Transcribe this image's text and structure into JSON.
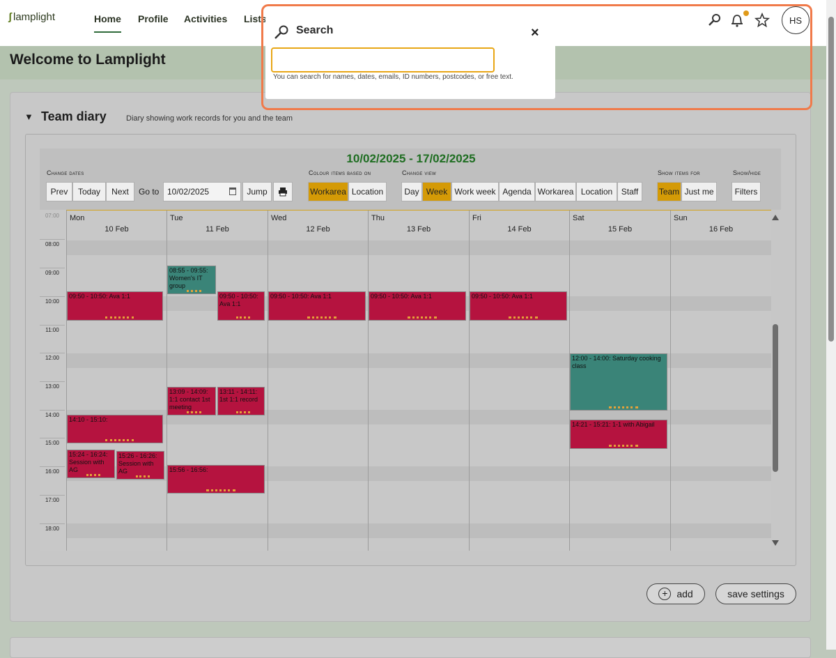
{
  "app": {
    "logo_text": "lamplight"
  },
  "nav": {
    "items": [
      {
        "label": "Home"
      },
      {
        "label": "Profile"
      },
      {
        "label": "Activities"
      },
      {
        "label": "Lists"
      }
    ],
    "user_initials": "HS"
  },
  "page": {
    "title": "Welcome to Lamplight"
  },
  "diary": {
    "title": "Team diary",
    "description": "Diary showing work records for you and the team",
    "range_title": "10/02/2025 - 17/02/2025",
    "labels": {
      "change_dates": "Change dates",
      "colour_items": "Colour items based on",
      "change_view": "Change view",
      "show_items_for": "Show items for",
      "show_hide": "Show/hide"
    },
    "buttons": {
      "prev": "Prev",
      "today": "Today",
      "next": "Next",
      "go_to": "Go to",
      "jump": "Jump",
      "workarea": "Workarea",
      "location": "Location",
      "day": "Day",
      "week": "Week",
      "work_week": "Work week",
      "agenda": "Agenda",
      "view_workarea": "Workarea",
      "view_location": "Location",
      "staff": "Staff",
      "team": "Team",
      "just_me": "Just me",
      "filters": "Filters"
    },
    "date_value": "10/02/2025",
    "days": [
      {
        "name": "Mon",
        "date": "10 Feb"
      },
      {
        "name": "Tue",
        "date": "11 Feb"
      },
      {
        "name": "Wed",
        "date": "12 Feb"
      },
      {
        "name": "Thu",
        "date": "13 Feb"
      },
      {
        "name": "Fri",
        "date": "14 Feb"
      },
      {
        "name": "Sat",
        "date": "15 Feb"
      },
      {
        "name": "Sun",
        "date": "16 Feb"
      }
    ],
    "hours": [
      "07:00",
      "08:00",
      "09:00",
      "10:00",
      "11:00",
      "12:00",
      "13:00",
      "14:00",
      "15:00",
      "16:00",
      "17:00",
      "18:00"
    ],
    "events": {
      "tue_women": "08:55 - 09:55: Women's IT group",
      "mon_ava": "09:50 - 10:50: Ava 1:1",
      "tue_ava": "09:50 - 10:50: Ava 1:1",
      "wed_ava": "09:50 - 10:50: Ava 1:1",
      "thu_ava": "09:50 - 10:50: Ava 1:1",
      "fri_ava": "09:50 - 10:50: Ava 1:1",
      "sat_cooking": "12:00 - 14:00: Saturday cooking class",
      "tue_contact": "13:09 - 14:09: 1:1 contact 1st meeting",
      "tue_record": "13:11 - 14:11: 1st 1:1 record",
      "mon_1410": "14:10 - 15:10:",
      "sat_abigail": "14:21 - 15:21: 1-1 with Abigail",
      "mon_1524": "15:24 - 16:24: Session with AG",
      "mon_1526": "15:26 - 16:26: Session with AG",
      "tue_1556": "15:56 - 16:56:"
    },
    "add_label": "add",
    "save_settings_label": "save settings"
  },
  "search": {
    "title": "Search",
    "value": "",
    "hint": "You can search for names, dates, emails, ID numbers, postcodes, or free text."
  },
  "colors": {
    "accent": "#d49a06",
    "event_red": "#b5133f",
    "event_teal": "#3a8478",
    "range_green": "#1f6e22",
    "highlight": "#f07a4a"
  }
}
